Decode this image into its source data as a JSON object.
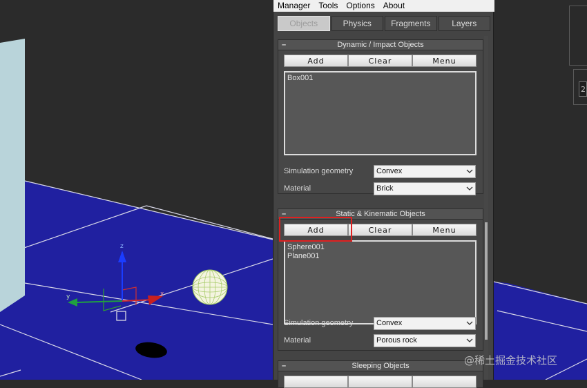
{
  "menubar": {
    "items": [
      "Manager",
      "Tools",
      "Options",
      "About"
    ]
  },
  "tabs": [
    {
      "label": "Objects",
      "active": true
    },
    {
      "label": "Physics",
      "active": false
    },
    {
      "label": "Fragments",
      "active": false
    },
    {
      "label": "Layers",
      "active": false
    }
  ],
  "rollouts": {
    "dynamic": {
      "collapse": "–",
      "title": "Dynamic / Impact Objects",
      "buttons": {
        "add": "Add",
        "clear": "Clear",
        "menu": "Menu"
      },
      "list": [
        "Box001"
      ],
      "sim_label": "Simulation geometry",
      "sim_value": "Convex",
      "material_label": "Material",
      "material_value": "Brick"
    },
    "static": {
      "collapse": "–",
      "title": "Static & Kinematic Objects",
      "buttons": {
        "add": "Add",
        "clear": "Clear",
        "menu": "Menu"
      },
      "list": [
        "Sphere001",
        "Plane001"
      ],
      "sim_label": "Simulation geometry",
      "sim_value": "Convex",
      "material_label": "Material",
      "material_value": "Porous rock"
    },
    "sleeping": {
      "collapse": "–",
      "title": "Sleeping Objects"
    }
  },
  "viewport": {
    "gizmo_labels": {
      "x": "x",
      "y": "y",
      "z": "z"
    },
    "ground_color": "#2020a0",
    "background_color": "#2b2b2b"
  },
  "right_strip": {
    "field_text": "2"
  },
  "watermark": "@稀土掘金技术社区",
  "colors": {
    "highlight": "#e02020",
    "panel_bg": "#444444",
    "tab_active": "#c9c9c9"
  }
}
